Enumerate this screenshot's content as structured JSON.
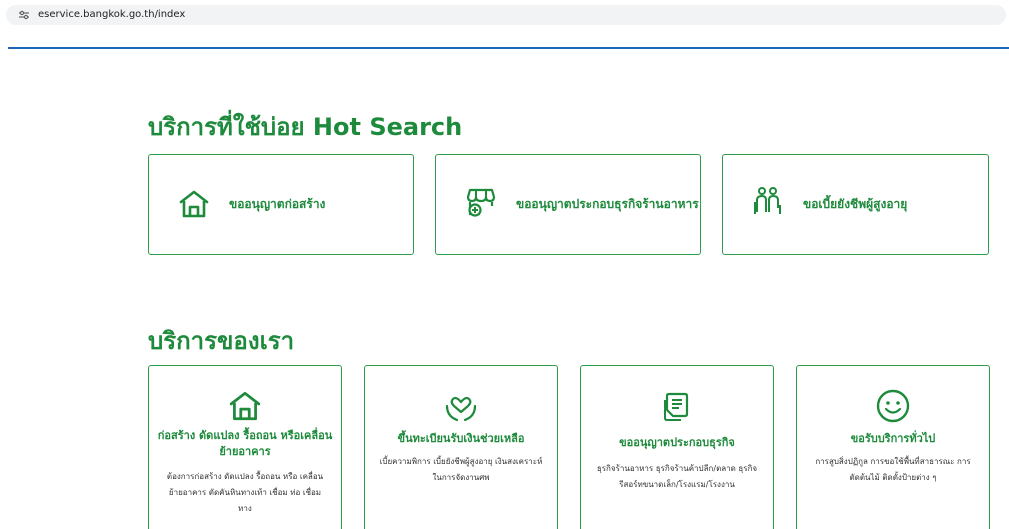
{
  "browser": {
    "url": "eservice.bangkok.go.th/index",
    "site_icon": "tune-icon"
  },
  "hot_search": {
    "title": "บริการที่ใช้บ่อย Hot Search",
    "cards": [
      {
        "label": "ขออนุญาตก่อสร้าง",
        "icon": "house-icon"
      },
      {
        "label": "ขออนุญาตประกอบธุรกิจร้านอาหาร",
        "icon": "shop-add-icon"
      },
      {
        "label": "ขอเบี้ยยังชีพผู้สูงอายุ",
        "icon": "elderly-couple-icon"
      }
    ]
  },
  "our_services": {
    "title": "บริการของเรา",
    "cards": [
      {
        "title": "ก่อสร้าง ดัดแปลง รื้อถอน หรือเคลื่อนย้ายอาคาร",
        "desc": "ต้องการก่อสร้าง ดัดแปลง รื้อถอน หรือ เคลื่อนย้ายอาคาร ตัดคันหินทางเท้า เชื่อม ท่อ เชื่อมทาง",
        "icon": "house-icon"
      },
      {
        "title": "ขึ้นทะเบียนรับเงินช่วยเหลือ",
        "desc": "เบี้ยความพิการ เบี้ยยังชีพผู้สูงอายุ เงินสงเคราะห์ในการจัดงานศพ",
        "icon": "heart-hands-icon"
      },
      {
        "title": "ขออนุญาตประกอบธุรกิจ",
        "desc": "ธุรกิจร้านอาหาร ธุรกิจร้านค้าปลีก/ตลาด ธุรกิจรีสอร์ทขนาดเล็ก/โรงแรม/โรงงาน",
        "icon": "document-icon"
      },
      {
        "title": "ขอรับบริการทั่วไป",
        "desc": "การสูบสิ่งปฏิกูล การขอใช้พื้นที่สาธารณะ การตัดต้นไม้ ติดตั้งป้ายต่าง ๆ",
        "icon": "smiley-icon"
      }
    ]
  },
  "colors": {
    "accent": "#1e8a3c",
    "border": "#2e9e4a",
    "rule": "#1a66b8"
  }
}
